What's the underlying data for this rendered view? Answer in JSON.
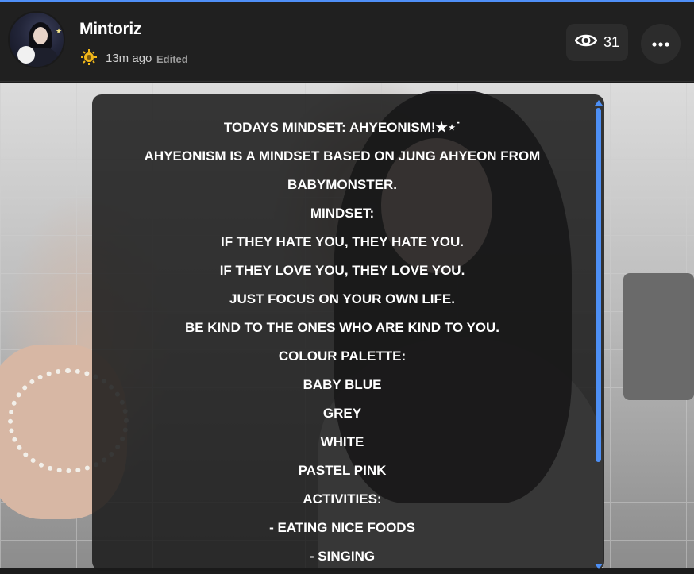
{
  "colors": {
    "accent": "#4f8ff7",
    "header_bg": "#202020",
    "button_bg": "#2c2c2c",
    "text": "#ffffff",
    "level_icon": "#f2b81a"
  },
  "post": {
    "author": {
      "name": "Mintoriz",
      "avatar_icon": "avatar-image",
      "level_icon": "sun-badge-icon"
    },
    "time": "13m ago",
    "edited_label": "Edited",
    "views": {
      "icon": "eye-icon",
      "count": "31"
    },
    "more_icon": "ellipsis-icon",
    "lines": [
      "TODAYS MINDSET: AHYEONISM!★⋆˙",
      "AHYEONISM IS A MINDSET BASED ON JUNG AHYEON FROM",
      "BABYMONSTER.",
      "MINDSET:",
      "IF THEY HATE YOU, THEY HATE YOU.",
      "IF THEY LOVE YOU, THEY LOVE YOU.",
      "JUST FOCUS ON YOUR OWN LIFE.",
      "BE KIND TO THE ONES WHO ARE KIND TO YOU.",
      "COLOUR PALETTE:",
      "BABY BLUE",
      "GREY",
      "WHITE",
      "PASTEL PINK",
      "ACTIVITIES:",
      "- EATING NICE FOODS",
      "- SINGING"
    ]
  }
}
